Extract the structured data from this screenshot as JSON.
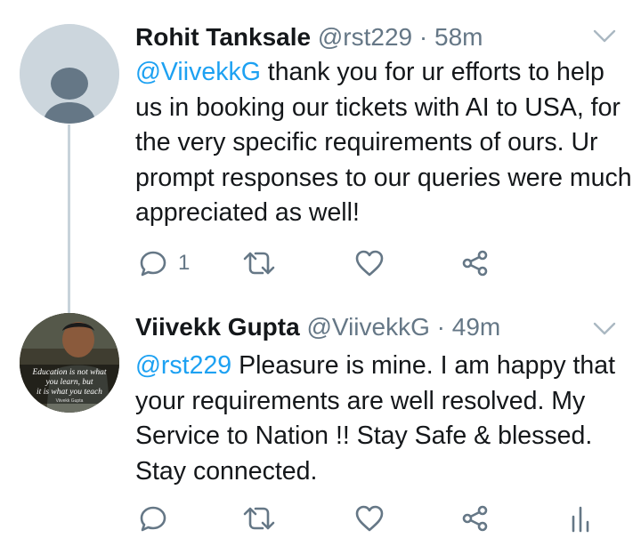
{
  "tweets": [
    {
      "name": "Rohit Tanksale",
      "handle": "@rst229",
      "sep": "·",
      "time": "58m",
      "mention": "@ViivekkG",
      "text": " thank you for ur efforts to help us in booking our tickets with AI to USA, for the very specific requirements of ours. Ur prompt responses to our queries were much appreciated as well!",
      "reply_count": "1"
    },
    {
      "name": "Viivekk Gupta",
      "handle": "@ViivekkG",
      "sep": "·",
      "time": "49m",
      "mention": "@rst229",
      "text": " Pleasure is mine. I am happy that your requirements are well resolved. My Service to Nation !! Stay Safe & blessed. Stay connected.",
      "reply_count": ""
    }
  ],
  "avatar2_text": [
    "Education is not what",
    "you learn, but",
    "it is what you teach",
    "Viivekk Gupta"
  ],
  "colors": {
    "link": "#1da1f2",
    "icon": "#657786",
    "thread_line": "#c8d3da"
  }
}
